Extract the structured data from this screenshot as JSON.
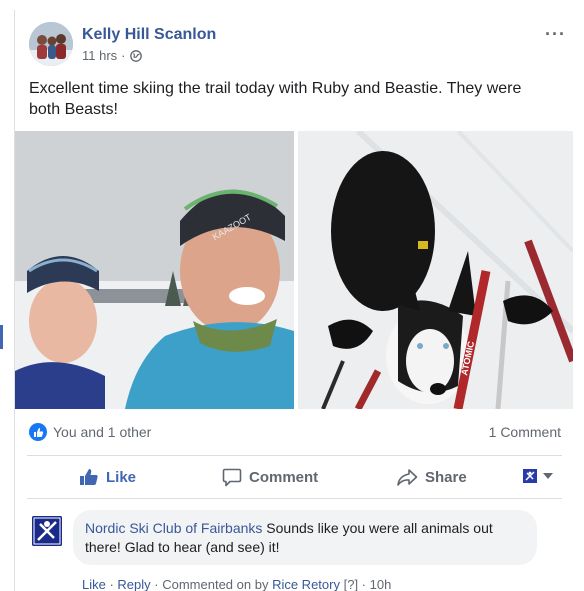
{
  "post": {
    "author": "Kelly Hill Scanlon",
    "time": "11 hrs",
    "dot": "·",
    "more": "···",
    "text": "Excellent time skiing the trail today with Ruby and Beastie. They were both Beasts!"
  },
  "photos": {
    "left": {
      "label": "",
      "hat_text": "KAAZOOT"
    },
    "right": {
      "ski_brand": "ATOMIC"
    }
  },
  "reactions": {
    "summary": "You and 1 other",
    "comments": "1 Comment"
  },
  "actions": {
    "like": "Like",
    "comment": "Comment",
    "share": "Share"
  },
  "comment": {
    "author": "Nordic Ski Club of Fairbanks",
    "text": " Sounds like you were all animals out there! Glad to hear (and see) it!",
    "like": "Like",
    "sep": " · ",
    "reply": "Reply",
    "commented_on_by": " · Commented on by ",
    "commenter": "Rice Retory",
    "tag": " [?]",
    "time": " · 10h"
  },
  "colors": {
    "brand": "#4267b2",
    "link": "#385898",
    "muted": "#616770"
  }
}
